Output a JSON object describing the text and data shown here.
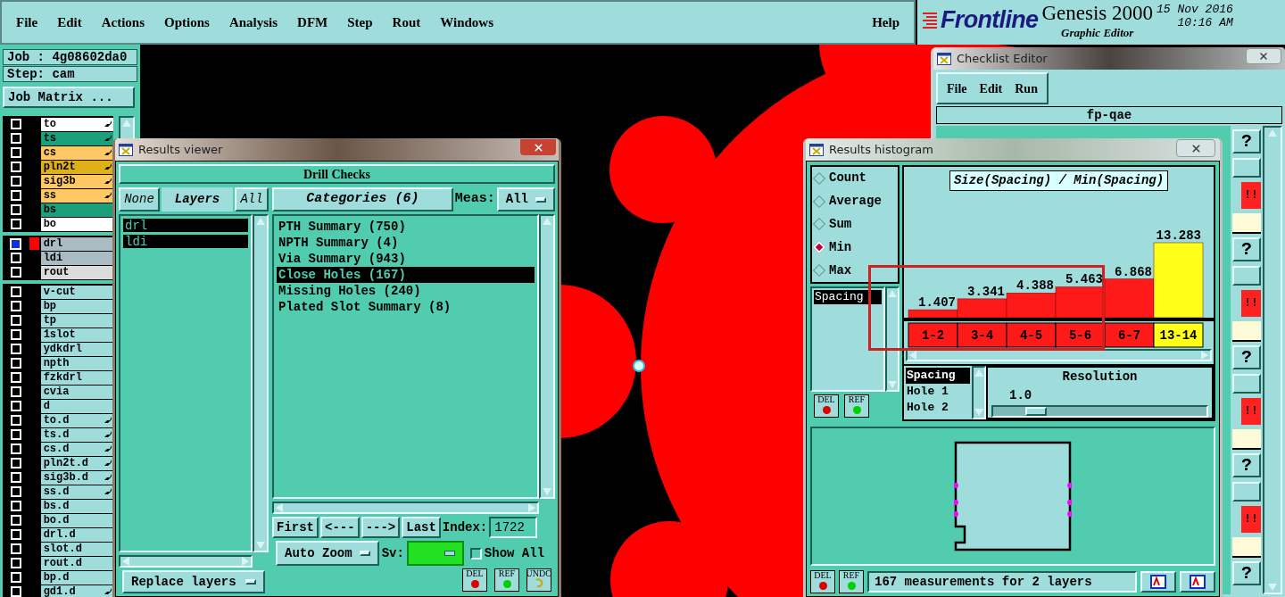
{
  "menu_bar": {
    "items": [
      "File",
      "Edit",
      "Actions",
      "Options",
      "Analysis",
      "DFM",
      "Step",
      "Rout",
      "Windows"
    ],
    "help": "Help"
  },
  "branding": {
    "logo": "Frontline",
    "product": "Genesis 2000",
    "subtitle": "Graphic Editor",
    "date": "15 Nov 2016",
    "time": "10:16 AM"
  },
  "job_panel": {
    "job": "Job : 4g08602da0",
    "step": "Step: cam",
    "matrix_button": "Job Matrix ...",
    "layer_groups": [
      {
        "layers": [
          {
            "name": "to",
            "color": "#ffffff",
            "linked": true,
            "active": false
          },
          {
            "name": "ts",
            "color": "#1aa07a",
            "linked": true,
            "active": false
          },
          {
            "name": "cs",
            "color": "#ffc862",
            "linked": true,
            "active": false
          },
          {
            "name": "pln2t",
            "color": "#e0b018",
            "linked": true,
            "active": false
          },
          {
            "name": "sig3b",
            "color": "#ffc862",
            "linked": true,
            "active": false
          },
          {
            "name": "ss",
            "color": "#ffc862",
            "linked": true,
            "active": false
          },
          {
            "name": "bs",
            "color": "#1aa07a",
            "linked": false,
            "active": false
          },
          {
            "name": "bo",
            "color": "#ffffff",
            "linked": false,
            "active": false
          }
        ]
      },
      {
        "layers": [
          {
            "name": "drl",
            "color": "#a9bcc4",
            "linked": false,
            "active": true
          },
          {
            "name": "ldi",
            "color": "#a9bcc4",
            "linked": false,
            "active": false
          },
          {
            "name": "rout",
            "color": "#dcdcdc",
            "linked": false,
            "active": false
          }
        ]
      },
      {
        "layers": [
          {
            "name": "v-cut",
            "color": "#9fdcdc",
            "linked": false,
            "active": false
          },
          {
            "name": "bp",
            "color": "#9fdcdc",
            "linked": false,
            "active": false
          },
          {
            "name": "tp",
            "color": "#9fdcdc",
            "linked": false,
            "active": false
          },
          {
            "name": "1slot",
            "color": "#9fdcdc",
            "linked": false,
            "active": false
          },
          {
            "name": "ydkdrl",
            "color": "#9fdcdc",
            "linked": false,
            "active": false
          },
          {
            "name": "npth",
            "color": "#9fdcdc",
            "linked": false,
            "active": false
          },
          {
            "name": "fzkdrl",
            "color": "#9fdcdc",
            "linked": false,
            "active": false
          },
          {
            "name": "cvia",
            "color": "#9fdcdc",
            "linked": false,
            "active": false
          },
          {
            "name": "d",
            "color": "#9fdcdc",
            "linked": false,
            "active": false
          },
          {
            "name": "to.d",
            "color": "#9fdcdc",
            "linked": true,
            "active": false
          },
          {
            "name": "ts.d",
            "color": "#9fdcdc",
            "linked": true,
            "active": false
          },
          {
            "name": "cs.d",
            "color": "#9fdcdc",
            "linked": true,
            "active": false
          },
          {
            "name": "pln2t.d",
            "color": "#9fdcdc",
            "linked": true,
            "active": false
          },
          {
            "name": "sig3b.d",
            "color": "#9fdcdc",
            "linked": true,
            "active": false
          },
          {
            "name": "ss.d",
            "color": "#9fdcdc",
            "linked": true,
            "active": false
          },
          {
            "name": "bs.d",
            "color": "#9fdcdc",
            "linked": false,
            "active": false
          },
          {
            "name": "bo.d",
            "color": "#9fdcdc",
            "linked": false,
            "active": false
          },
          {
            "name": "drl.d",
            "color": "#9fdcdc",
            "linked": false,
            "active": false
          },
          {
            "name": "slot.d",
            "color": "#9fdcdc",
            "linked": false,
            "active": false
          },
          {
            "name": "rout.d",
            "color": "#9fdcdc",
            "linked": false,
            "active": false
          },
          {
            "name": "bp.d",
            "color": "#9fdcdc",
            "linked": false,
            "active": false
          },
          {
            "name": "gd1.d",
            "color": "#9fdcdc",
            "linked": true,
            "active": false
          }
        ]
      }
    ]
  },
  "checklist_editor": {
    "title": "Checklist Editor",
    "menu": [
      "File",
      "Edit",
      "Run"
    ],
    "checklist_name": "fp-qae",
    "checks": [
      {
        "help": "?",
        "alert": "!!"
      },
      {
        "help": "?",
        "alert": "!!"
      },
      {
        "help": "?",
        "alert": "!!"
      },
      {
        "help": "?",
        "alert": "!!"
      },
      {
        "help": "?"
      }
    ]
  },
  "results_viewer": {
    "title": "Results viewer",
    "header": "Drill Checks",
    "layer_buttons": {
      "none": "None",
      "label": "Layers",
      "all": "All"
    },
    "layers": [
      {
        "name": "drl",
        "selected": true
      },
      {
        "name": "ldi",
        "selected": true
      }
    ],
    "categories_header": "Categories (6)",
    "meas_label": "Meas:",
    "meas_value": "All",
    "categories": [
      {
        "name": "PTH Summary (750)",
        "selected": false
      },
      {
        "name": "NPTH Summary (4)",
        "selected": false
      },
      {
        "name": "Via Summary (943)",
        "selected": false
      },
      {
        "name": "Close Holes (167)",
        "selected": true
      },
      {
        "name": "Missing Holes (240)",
        "selected": false
      },
      {
        "name": "Plated Slot Summary (8)",
        "selected": false
      }
    ],
    "nav": [
      "First",
      "<---",
      "--->",
      "Last"
    ],
    "index_label": "Index:",
    "index_value": "1722",
    "zoom_mode": "Auto Zoom",
    "sv_label": "Sv:",
    "show_all": {
      "label": "Show All",
      "checked": false
    },
    "actions": [
      "DEL",
      "REF",
      "UNDO"
    ],
    "replace_mode": "Replace layers"
  },
  "histogram": {
    "title": "Results histogram",
    "stats": [
      {
        "label": "Count",
        "selected": false
      },
      {
        "label": "Average",
        "selected": false
      },
      {
        "label": "Sum",
        "selected": false
      },
      {
        "label": "Min",
        "selected": true
      },
      {
        "label": "Max",
        "selected": false
      }
    ],
    "measures": [
      {
        "name": "Spacing",
        "selected": true
      }
    ],
    "side_actions": [
      "DEL",
      "REF"
    ],
    "chart_data": {
      "type": "bar",
      "title": "Size(Spacing) / Min(Spacing)",
      "categories": [
        "1-2",
        "3-4",
        "4-5",
        "5-6",
        "6-7",
        "13-14"
      ],
      "stacked": true,
      "data_labels": true,
      "series": [
        {
          "color": "#ff1a1a",
          "values": [
            1.407,
            3.341,
            4.388,
            5.463,
            6.868,
            null
          ]
        },
        {
          "color": "#ffff1a",
          "values": [
            null,
            null,
            null,
            null,
            null,
            13.283
          ]
        }
      ]
    },
    "fields": [
      {
        "name": "Spacing",
        "selected": true
      },
      {
        "name": "Hole 1",
        "selected": false
      },
      {
        "name": "Hole 2",
        "selected": false
      }
    ],
    "resolution": {
      "label": "Resolution",
      "value": "1.0",
      "level": 0.15
    },
    "bottom_actions": [
      "DEL",
      "REF"
    ],
    "status": "167 measurements for 2 layers"
  }
}
